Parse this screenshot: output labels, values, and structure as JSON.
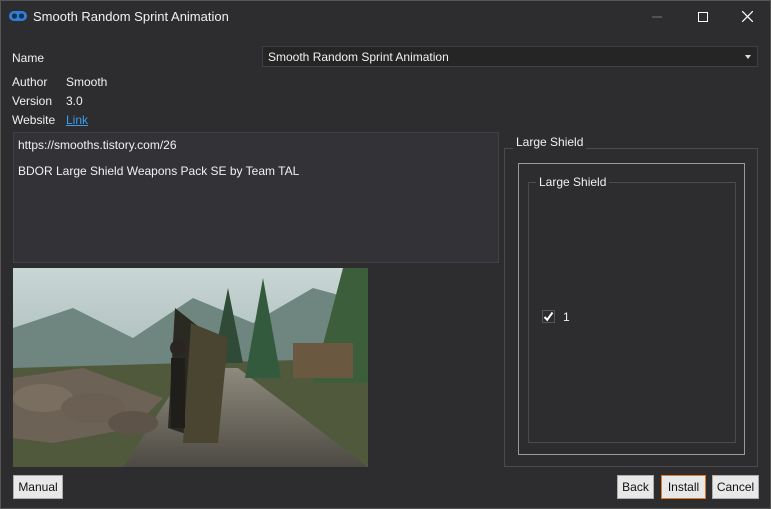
{
  "window": {
    "title": "Smooth Random Sprint Animation"
  },
  "fields": {
    "name_label": "Name",
    "name_value": "Smooth Random Sprint Animation",
    "author_label": "Author",
    "author_value": "Smooth",
    "version_label": "Version",
    "version_value": "3.0",
    "website_label": "Website",
    "website_value": "Link"
  },
  "description": {
    "line1": "https://smooths.tistory.com/26",
    "line2": "BDOR Large Shield Weapons Pack SE by Team TAL"
  },
  "options": {
    "group_title": "Large Shield",
    "subgroup_title": "Large Shield",
    "checkbox_label": "1",
    "checkbox_checked": true
  },
  "buttons": {
    "manual": "Manual",
    "back": "Back",
    "install": "Install",
    "cancel": "Cancel"
  },
  "icons": {
    "app": "app-logo-icon",
    "minimize": "minimize-icon",
    "maximize": "maximize-icon",
    "close": "close-icon",
    "dropdown": "chevron-down-icon",
    "check": "checkmark-icon"
  },
  "colors": {
    "background": "#2d2d30",
    "link": "#3d9be9",
    "accent": "#e07b2a",
    "text": "#f1f1f1"
  }
}
